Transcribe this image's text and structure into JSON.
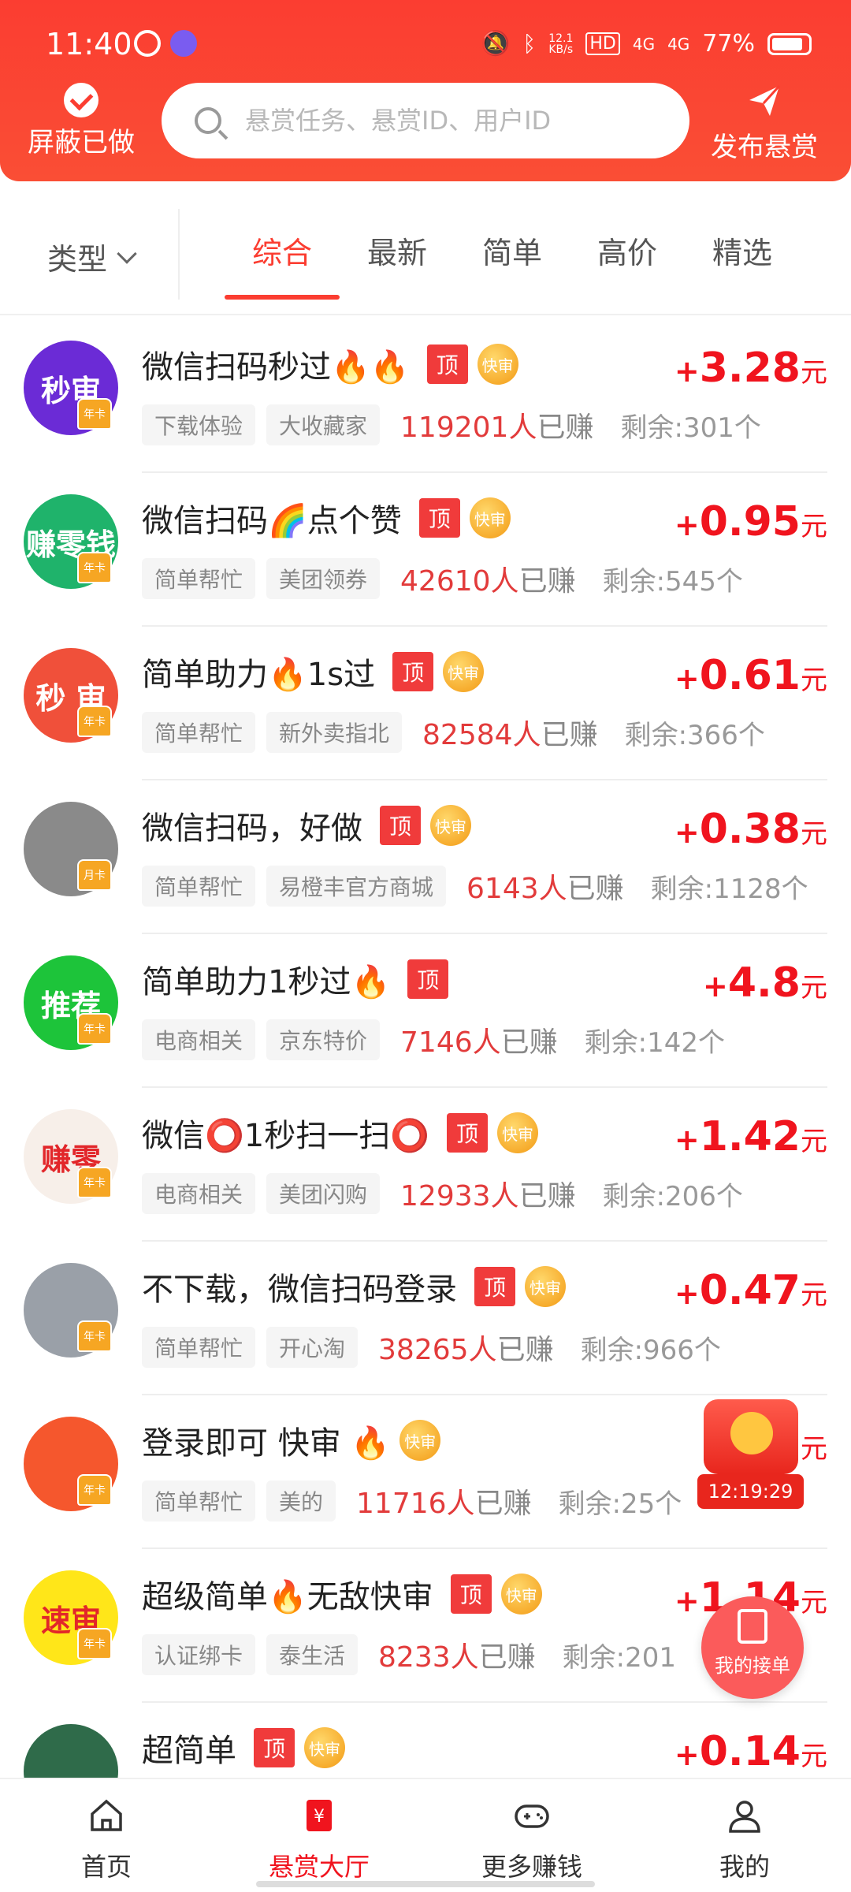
{
  "status_bar": {
    "time": "11:40",
    "speed_top": "12.1",
    "speed_unit": "KB/s",
    "net1": "HD",
    "net2": "4G",
    "net3": "4G",
    "battery": "77%"
  },
  "header": {
    "shield_label": "屏蔽已做",
    "search_placeholder": "悬赏任务、悬赏ID、用户ID",
    "publish_label": "发布悬赏"
  },
  "filter": {
    "type_label": "类型",
    "tabs": [
      "综合",
      "最新",
      "简单",
      "高价",
      "精选"
    ],
    "active_tab": "综合"
  },
  "tasks": [
    {
      "title": "微信扫码秒过🔥🔥",
      "top": true,
      "fast": true,
      "tags": [
        "下载体验",
        "大收藏家"
      ],
      "earned": "119201人",
      "earned_suffix": "已赚",
      "remain": "剩余:301个",
      "price_plus": "+",
      "price": "3.28",
      "unit": "元",
      "avatar_text": "秒审",
      "avatar_color": "#6b2bd6",
      "crown": "年卡"
    },
    {
      "title": "微信扫码🌈点个赞",
      "top": true,
      "fast": true,
      "tags": [
        "简单帮忙",
        "美团领券"
      ],
      "earned": "42610人",
      "earned_suffix": "已赚",
      "remain": "剩余:545个",
      "price_plus": "+",
      "price": "0.95",
      "unit": "元",
      "avatar_text": "赚零钱",
      "avatar_color": "#1fb36b",
      "crown": "年卡"
    },
    {
      "title": "简单助力🔥1s过",
      "top": true,
      "fast": true,
      "tags": [
        "简单帮忙",
        "新外卖指北"
      ],
      "earned": "82584人",
      "earned_suffix": "已赚",
      "remain": "剩余:366个",
      "price_plus": "+",
      "price": "0.61",
      "unit": "元",
      "avatar_text": "秒 审",
      "avatar_color": "#f0503a",
      "crown": "年卡"
    },
    {
      "title": "微信扫码，好做",
      "top": true,
      "fast": true,
      "tags": [
        "简单帮忙",
        "易橙丰官方商城"
      ],
      "earned": "6143人",
      "earned_suffix": "已赚",
      "remain": "剩余:1128个",
      "price_plus": "+",
      "price": "0.38",
      "unit": "元",
      "avatar_text": "",
      "avatar_color": "#8a8a8a",
      "crown": "月卡"
    },
    {
      "title": "简单助力1秒过🔥",
      "top": true,
      "fast": false,
      "tags": [
        "电商相关",
        "京东特价"
      ],
      "earned": "7146人",
      "earned_suffix": "已赚",
      "remain": "剩余:142个",
      "price_plus": "+",
      "price": "4.8",
      "unit": "元",
      "avatar_text": "推荐",
      "avatar_color": "#1dc43a",
      "crown": "年卡"
    },
    {
      "title": "微信⭕1秒扫一扫⭕",
      "top": true,
      "fast": true,
      "tags": [
        "电商相关",
        "美团闪购"
      ],
      "earned": "12933人",
      "earned_suffix": "已赚",
      "remain": "剩余:206个",
      "price_plus": "+",
      "price": "1.42",
      "unit": "元",
      "avatar_text": "赚零",
      "avatar_color": "#f7efe9",
      "crown": "年卡"
    },
    {
      "title": "不下载，微信扫码登录",
      "top": true,
      "fast": true,
      "tags": [
        "简单帮忙",
        "开心淘"
      ],
      "earned": "38265人",
      "earned_suffix": "已赚",
      "remain": "剩余:966个",
      "price_plus": "+",
      "price": "0.47",
      "unit": "元",
      "avatar_text": "",
      "avatar_color": "#9aa0a8",
      "crown": "年卡"
    },
    {
      "title": "登录即可  快审  🔥",
      "top": false,
      "fast": true,
      "tags": [
        "简单帮忙",
        "美的"
      ],
      "earned": "11716人",
      "earned_suffix": "已赚",
      "remain": "剩余:25个",
      "price_plus": "",
      "price": "",
      "unit": "元",
      "avatar_text": "",
      "avatar_color": "#f5572d",
      "crown": "年卡"
    },
    {
      "title": "超级简单🔥无敌快审",
      "top": true,
      "fast": true,
      "tags": [
        "认证绑卡",
        "泰生活"
      ],
      "earned": "8233人",
      "earned_suffix": "已赚",
      "remain": "剩余:201",
      "price_plus": "+",
      "price": "1.14",
      "unit": "元",
      "avatar_text": "速审",
      "avatar_color": "#ffe619",
      "crown": "年卡"
    },
    {
      "title": "超简单",
      "top": true,
      "fast": true,
      "tags": [],
      "earned": "",
      "earned_suffix": "",
      "remain": "",
      "price_plus": "+",
      "price": "0.14",
      "unit": "元",
      "avatar_text": "",
      "avatar_color": "#2f6b4a",
      "crown": ""
    }
  ],
  "badges": {
    "top": "顶",
    "fast": "快审"
  },
  "floating": {
    "redpack_timer": "12:19:29",
    "my_orders": "我的接单"
  },
  "bottom_nav": [
    {
      "label": "首页",
      "icon": "home-icon"
    },
    {
      "label": "悬赏大厅",
      "icon": "bounty-hall-icon"
    },
    {
      "label": "更多赚钱",
      "icon": "gamepad-icon"
    },
    {
      "label": "我的",
      "icon": "user-icon"
    }
  ],
  "colors": {
    "brand": "#fb3d31",
    "price": "#f0141e",
    "fast": "#f39a14"
  }
}
